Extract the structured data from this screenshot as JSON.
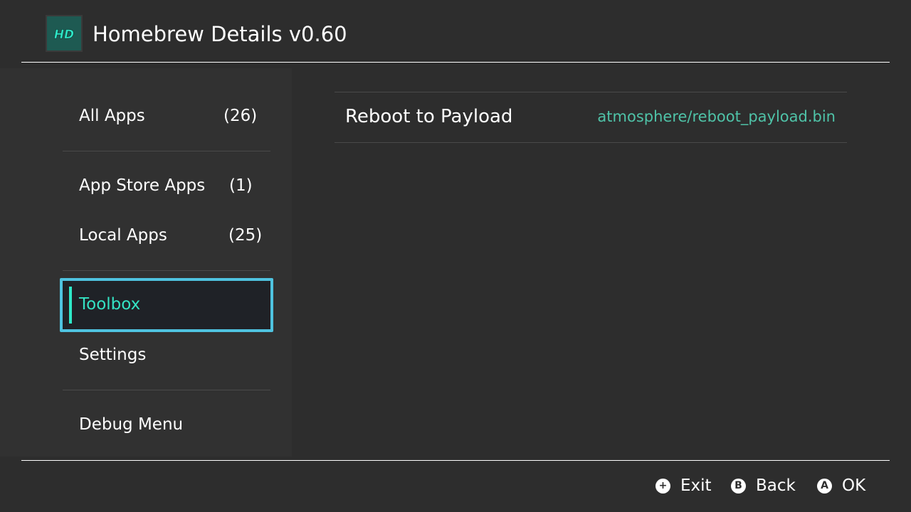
{
  "header": {
    "logo_text": "HD",
    "title": "Homebrew Details v0.60"
  },
  "sidebar": {
    "items": [
      {
        "label": "All Apps",
        "count": "(26)"
      },
      {
        "label": "App Store Apps",
        "count": "(1)"
      },
      {
        "label": "Local Apps",
        "count": "(25)"
      },
      {
        "label": "Toolbox",
        "selected": true
      },
      {
        "label": "Settings"
      },
      {
        "label": "Debug Menu"
      }
    ]
  },
  "main": {
    "rows": [
      {
        "label": "Reboot to Payload",
        "value": "atmosphere/reboot_payload.bin"
      }
    ]
  },
  "footer": {
    "buttons": [
      {
        "icon": "plus-button-icon",
        "glyph": "+",
        "label": "Exit"
      },
      {
        "icon": "b-button-icon",
        "glyph": "B",
        "label": "Back"
      },
      {
        "icon": "a-button-icon",
        "glyph": "A",
        "label": "OK"
      }
    ]
  },
  "colors": {
    "background": "#2d2d2d",
    "sidebar": "#313131",
    "accent_teal": "#34e3c4",
    "selection_border": "#4fc3e0",
    "value_text": "#4fc3a8"
  }
}
